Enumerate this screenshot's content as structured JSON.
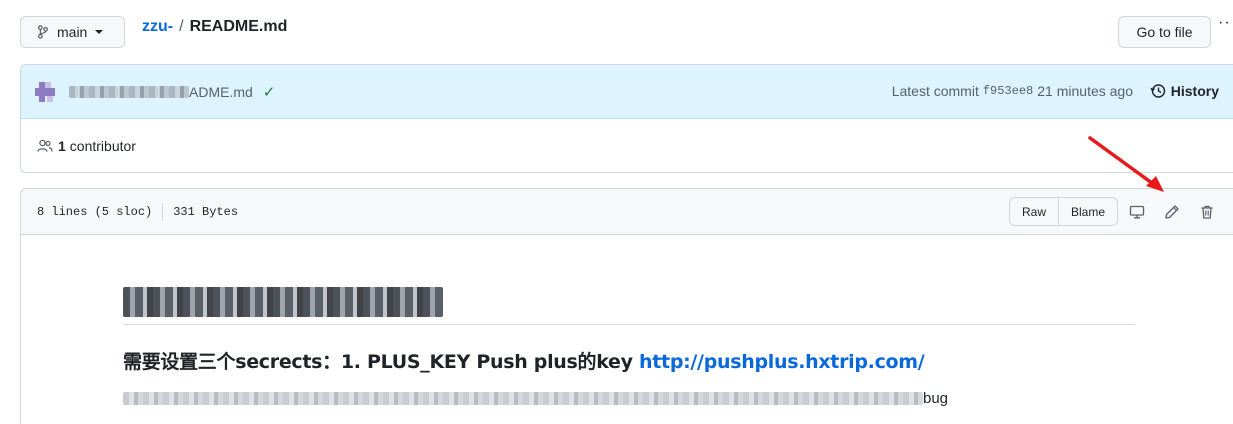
{
  "topbar": {
    "branch": "main",
    "repo": "zzu-",
    "separator": "/",
    "file": "README.md",
    "goto_file": "Go to file",
    "more": "··"
  },
  "commit": {
    "message_visible": "ADME.md",
    "status": "✓",
    "latest_label": "Latest commit",
    "sha": "f953ee8",
    "time": "21 minutes ago",
    "history": "History"
  },
  "contributors": {
    "count": "1",
    "label": "contributor"
  },
  "file_header": {
    "lines": "8 lines (5 sloc)",
    "size": "331 Bytes",
    "raw": "Raw",
    "blame": "Blame"
  },
  "readme": {
    "subheading": "需要设置三个secrects：1. PLUS_KEY Push plus的key ",
    "subheading_link": "http://pushplus.hxtrip.com/",
    "para_tail": "bug"
  },
  "colors": {
    "accent": "#0969da",
    "commit_bg": "#ddf4ff",
    "success": "#1a7f37",
    "annotation_arrow": "#e8191a"
  },
  "icons": [
    "branch-icon",
    "caret-down-icon",
    "check-icon",
    "history-icon",
    "people-icon",
    "desktop-icon",
    "pencil-icon",
    "trash-icon"
  ]
}
